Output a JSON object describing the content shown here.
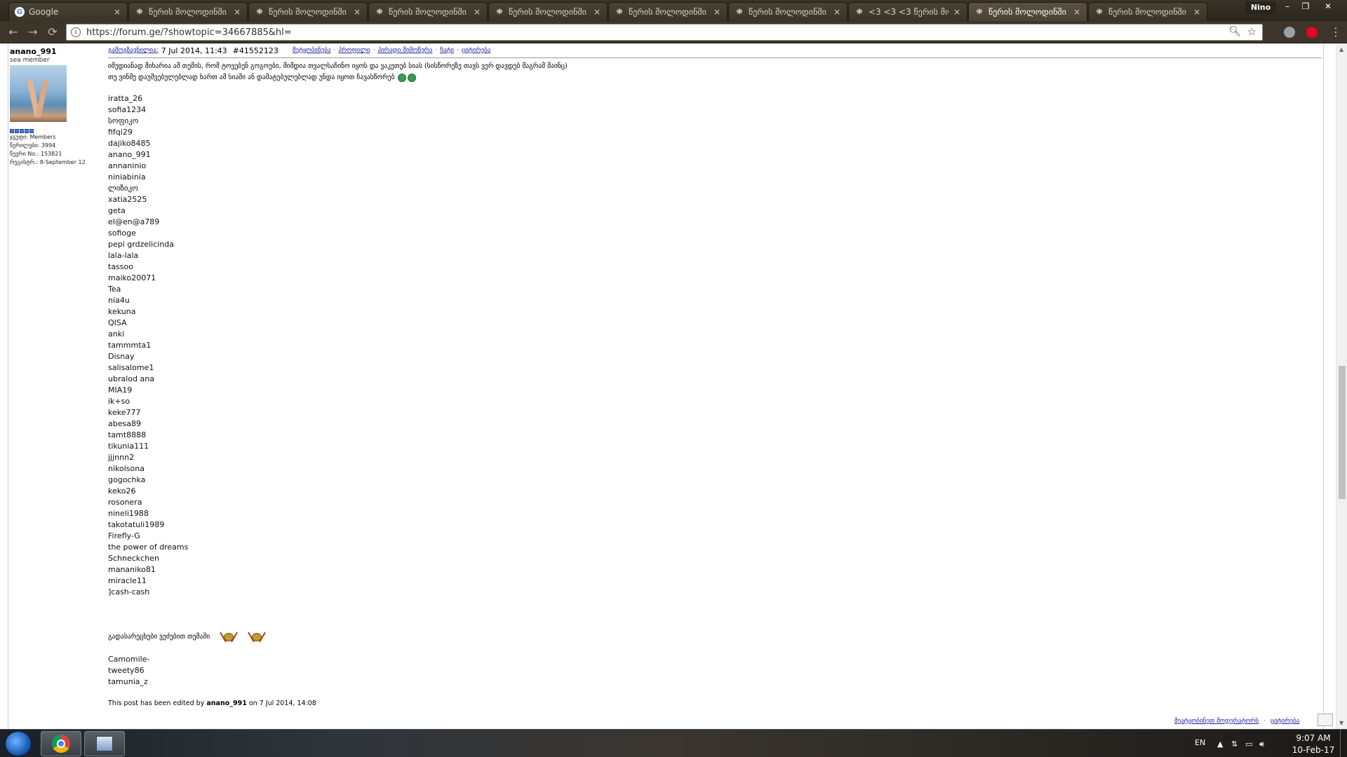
{
  "browser": {
    "tabs": [
      {
        "title": "Google",
        "favicon": "google-icon",
        "active": false
      },
      {
        "title": "წერის მოლოდინში",
        "favicon": "forum-icon",
        "active": false
      },
      {
        "title": "წერის მოლოდინში",
        "favicon": "forum-icon",
        "active": false
      },
      {
        "title": "წერის მოლოდინში",
        "favicon": "forum-icon",
        "active": false
      },
      {
        "title": "წერის მოლოდინში",
        "favicon": "forum-icon",
        "active": false
      },
      {
        "title": "წერის მოლოდინში",
        "favicon": "forum-icon",
        "active": false
      },
      {
        "title": "წერის მოლოდინში",
        "favicon": "forum-icon",
        "active": false
      },
      {
        "title": "<3 <3 <3 წერის მოლ",
        "favicon": "forum-icon",
        "active": false
      },
      {
        "title": "წერის მოლოდინში",
        "favicon": "forum-icon",
        "active": true
      },
      {
        "title": "წერის მოლოდინში",
        "favicon": "forum-icon",
        "active": false
      }
    ],
    "tab_close": "×",
    "window_user": "Nino",
    "url": "https://forum.ge/?showtopic=34667885&hl="
  },
  "post": {
    "author": {
      "name": "anano_991",
      "title": "sea member",
      "stats": [
        "ჯგუფი: Members",
        "წერილები: 3994",
        "წევრი No.: 153821",
        "რეგისტრ.: 8-September 12"
      ]
    },
    "header": {
      "posted_label": "გამოგზავნილია:",
      "datetime": "7 Jul 2014, 11:43",
      "post_id": "#41552123",
      "actions": [
        "შეტყობინება",
        "პროფილი",
        "პირადი მიმოწერა",
        "ჩატი",
        "ციტირება"
      ]
    },
    "intro_lines": [
      "იმედიანად მიხარია ამ თემის, რომ ტოვებენ გოგოები, მიმდია თვალსაჩინო იყოს და ვაკეთებ სიას (სისწორეზე თავს ვერ დავდებ მაგრამ მაინც)",
      "თუ ვინმე დაუშვებულებლად ხართ ამ სიაში ან დამატებულებლად უნდა იყოთ ჩავასწორებ"
    ],
    "names": [
      "iratta_26",
      "sofia1234",
      "სოფიკო",
      "fifqi29",
      "dajiko8485",
      "anano_991",
      "annaninio",
      "niniabinia",
      "ლიზიკო",
      "xatia2525",
      "geta",
      "el@en@a789",
      "sofioge",
      "pepi grdzelicinda",
      "lala-lala",
      "tassoo",
      "maiko20071",
      "Tea",
      "nia4u",
      "kekuna",
      "QISA",
      "anki",
      "tammmta1",
      "Disnay",
      "salisalome1",
      "ubralod ana",
      "MIA19",
      "ik+so",
      "keke777",
      "abesa89",
      "tamt8888",
      "tikunia111",
      "jjjnnn2",
      "nikolsona",
      "gogochka",
      "keko26",
      "rosonera",
      "nineli1988",
      "takotatuli1989",
      "Firefly-G",
      "the power of dreams",
      "Schneckchen",
      "mananiko81",
      "miracle11",
      "]cash-cash"
    ],
    "note": "გადასარეცხები ვეძებით თემაში",
    "names_extra": [
      "Camomile-",
      "tweety86",
      "tamunia_z"
    ],
    "edited": {
      "prefix": "This post has been edited by",
      "by": "anano_991",
      "suffix": "on 7 Jul 2014, 14:08"
    },
    "bottom_links": [
      "შეატყობინეთ მოდერატორს",
      "ციტირება"
    ]
  },
  "taskbar": {
    "lang": "EN",
    "time": "9:07 AM",
    "date": "10-Feb-17"
  }
}
